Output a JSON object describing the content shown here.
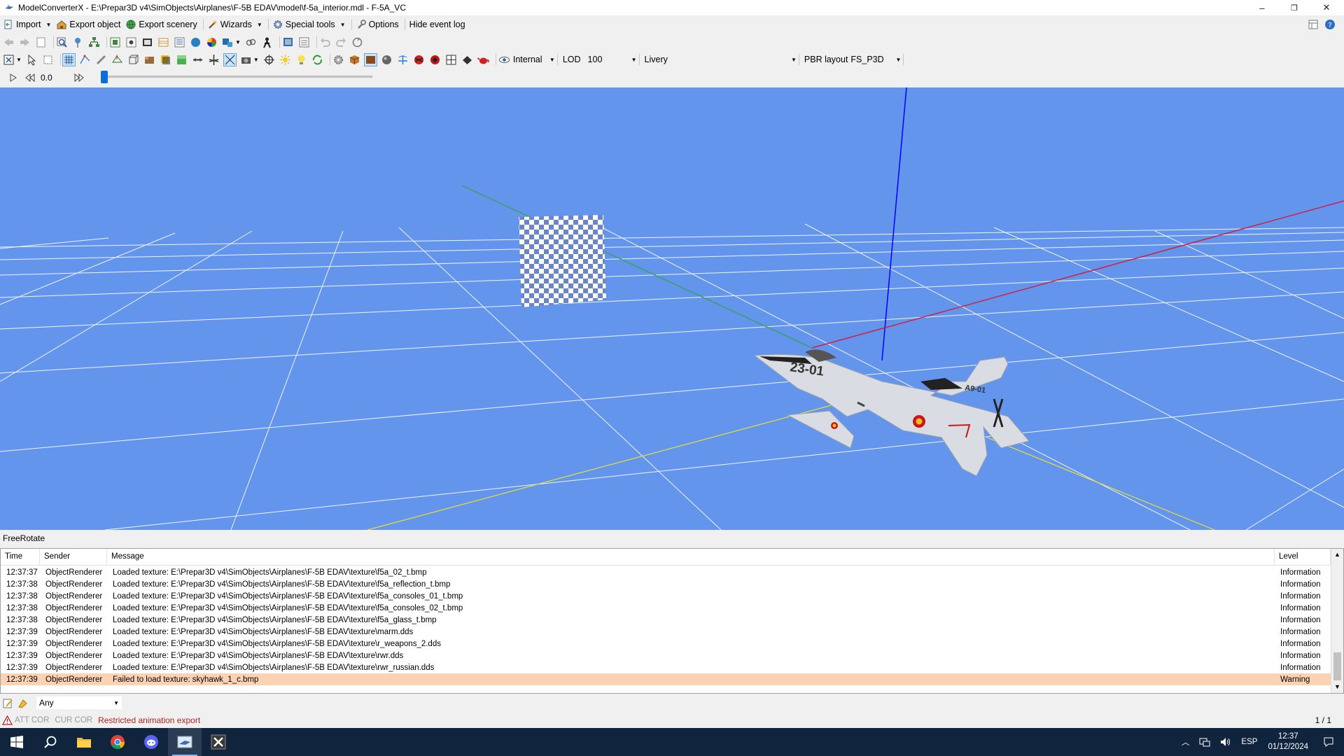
{
  "window": {
    "title": "ModelConverterX - E:\\Prepar3D v4\\SimObjects\\Airplanes\\F-5B EDAV\\model\\f-5a_interior.mdl - F-5A_VC",
    "minimize": "–",
    "maximize": "❐",
    "close": "✕"
  },
  "menu": {
    "import": "Import",
    "export_object": "Export object",
    "export_scenery": "Export scenery",
    "wizards": "Wizards",
    "special_tools": "Special tools",
    "options": "Options",
    "hide_event_log": "Hide event log"
  },
  "view_toolbar": {
    "view_mode": "Internal",
    "lod_label": "LOD",
    "lod_value": "100",
    "livery_label": "Livery",
    "livery_value": "",
    "pbr_label": "PBR layout",
    "pbr_value": "FS_P3D"
  },
  "animation": {
    "time_value": "0.0",
    "slider_fraction": 0.0
  },
  "viewport": {
    "background_color": "#6495ed",
    "aircraft_tail_code": "A9-01",
    "aircraft_nose_code": "23-01"
  },
  "status_mode": "FreeRotate",
  "log": {
    "columns": {
      "time": "Time",
      "sender": "Sender",
      "message": "Message",
      "level": "Level"
    },
    "rows": [
      {
        "time": "12:37:37",
        "sender": "ObjectRenderer",
        "message": "Loaded texture: E:\\Prepar3D v4\\SimObjects\\Airplanes\\F-5B EDAV\\texture\\f5a_02_t.bmp",
        "level": "Information"
      },
      {
        "time": "12:37:38",
        "sender": "ObjectRenderer",
        "message": "Loaded texture: E:\\Prepar3D v4\\SimObjects\\Airplanes\\F-5B EDAV\\texture\\f5a_reflection_t.bmp",
        "level": "Information"
      },
      {
        "time": "12:37:38",
        "sender": "ObjectRenderer",
        "message": "Loaded texture: E:\\Prepar3D v4\\SimObjects\\Airplanes\\F-5B EDAV\\texture\\f5a_consoles_01_t.bmp",
        "level": "Information"
      },
      {
        "time": "12:37:38",
        "sender": "ObjectRenderer",
        "message": "Loaded texture: E:\\Prepar3D v4\\SimObjects\\Airplanes\\F-5B EDAV\\texture\\f5a_consoles_02_t.bmp",
        "level": "Information"
      },
      {
        "time": "12:37:38",
        "sender": "ObjectRenderer",
        "message": "Loaded texture: E:\\Prepar3D v4\\SimObjects\\Airplanes\\F-5B EDAV\\texture\\f5a_glass_t.bmp",
        "level": "Information"
      },
      {
        "time": "12:37:39",
        "sender": "ObjectRenderer",
        "message": "Loaded texture: E:\\Prepar3D v4\\SimObjects\\Airplanes\\F-5B EDAV\\texture\\marm.dds",
        "level": "Information"
      },
      {
        "time": "12:37:39",
        "sender": "ObjectRenderer",
        "message": "Loaded texture: E:\\Prepar3D v4\\SimObjects\\Airplanes\\F-5B EDAV\\texture\\r_weapons_2.dds",
        "level": "Information"
      },
      {
        "time": "12:37:39",
        "sender": "ObjectRenderer",
        "message": "Loaded texture: E:\\Prepar3D v4\\SimObjects\\Airplanes\\F-5B EDAV\\texture\\rwr.dds",
        "level": "Information"
      },
      {
        "time": "12:37:39",
        "sender": "ObjectRenderer",
        "message": "Loaded texture: E:\\Prepar3D v4\\SimObjects\\Airplanes\\F-5B EDAV\\texture\\rwr_russian.dds",
        "level": "Information"
      },
      {
        "time": "12:37:39",
        "sender": "ObjectRenderer",
        "message": "Failed to load texture: skyhawk_1_c.bmp",
        "level": "Warning",
        "highlight": true
      }
    ],
    "warning_row_color": "#fbd3b3"
  },
  "filter": {
    "value": "Any"
  },
  "status_bar": {
    "att_cor": "ATT COR",
    "cur_cor": "CUR COR",
    "message": "Restricted animation export",
    "pager": "1 / 1"
  },
  "taskbar": {
    "language": "ESP",
    "time": "12:37",
    "date": "01/12/2024",
    "apps": [
      "start-icon",
      "search-icon",
      "file-explorer-icon",
      "chrome-icon",
      "discord-icon",
      "modelconverterx-icon",
      "xplane-icon"
    ]
  }
}
